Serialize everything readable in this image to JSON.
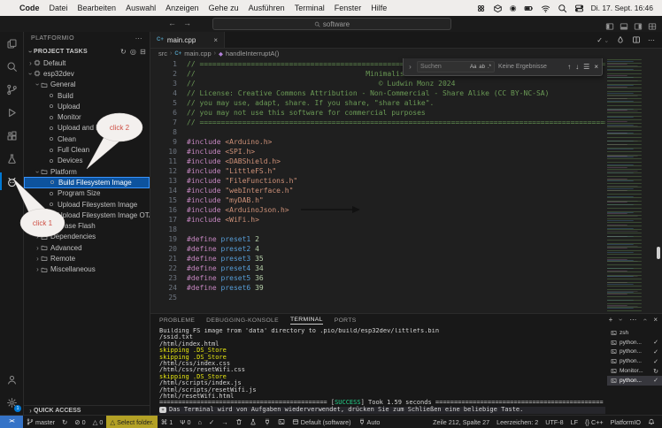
{
  "colors": {
    "accent": "#0078d4",
    "selBg": "#0d539e",
    "selBorder": "#3794ff",
    "remoteBlue": "#3573c7",
    "warnBadge": "#b3a125",
    "termYellow": "#e5e510",
    "success": "#23d18b",
    "annRed": "#cf4f44"
  },
  "menubar": {
    "apple": "",
    "items": [
      "Code",
      "Datei",
      "Bearbeiten",
      "Auswahl",
      "Anzeigen",
      "Gehe zu",
      "Ausführen",
      "Terminal",
      "Fenster",
      "Hilfe"
    ],
    "clock": "Di. 17. Sept. 16:46"
  },
  "titlebar": {
    "back": "←",
    "forward": "→",
    "search": "software"
  },
  "sidebar": {
    "title": "PLATFORMIO",
    "more": "⋯",
    "section": "PROJECT TASKS",
    "section_icons": [
      "refresh",
      "group",
      "collapse"
    ],
    "quick_access": "QUICK ACCESS",
    "tree": [
      {
        "label": "Default",
        "lvl": 1,
        "chev": "r",
        "icon": "board"
      },
      {
        "label": "esp32dev",
        "lvl": 1,
        "chev": "d",
        "icon": "board"
      },
      {
        "label": "General",
        "lvl": 2,
        "chev": "d",
        "icon": "folder"
      },
      {
        "label": "Build",
        "lvl": 3,
        "icon": "task"
      },
      {
        "label": "Upload",
        "lvl": 3,
        "icon": "task"
      },
      {
        "label": "Monitor",
        "lvl": 3,
        "icon": "task"
      },
      {
        "label": "Upload and Monitor",
        "lvl": 3,
        "icon": "task"
      },
      {
        "label": "Clean",
        "lvl": 3,
        "icon": "task"
      },
      {
        "label": "Full Clean",
        "lvl": 3,
        "icon": "task"
      },
      {
        "label": "Devices",
        "lvl": 3,
        "icon": "task"
      },
      {
        "label": "Platform",
        "lvl": 2,
        "chev": "d",
        "icon": "folder"
      },
      {
        "label": "Build Filesystem Image",
        "lvl": 3,
        "icon": "task",
        "selected": true
      },
      {
        "label": "Program Size",
        "lvl": 3,
        "icon": "task"
      },
      {
        "label": "Upload Filesystem Image",
        "lvl": 3,
        "icon": "task"
      },
      {
        "label": "Upload Filesystem Image OTA",
        "lvl": 3,
        "icon": "task"
      },
      {
        "label": "Erase Flash",
        "lvl": 3,
        "icon": "task"
      },
      {
        "label": "Dependencies",
        "lvl": 2,
        "chev": "r",
        "icon": "folder"
      },
      {
        "label": "Advanced",
        "lvl": 2,
        "chev": "r",
        "icon": "folder"
      },
      {
        "label": "Remote",
        "lvl": 2,
        "chev": "r",
        "icon": "folder"
      },
      {
        "label": "Miscellaneous",
        "lvl": 2,
        "chev": "r",
        "icon": "folder"
      }
    ]
  },
  "editor": {
    "tab_label": "main.cpp",
    "tab_close": "×",
    "breadcrumbs": [
      "src",
      "main.cpp",
      "handleInterruptA()"
    ],
    "find": {
      "placeholder": "Suchen",
      "opts": [
        "Aa",
        "ab",
        ".*"
      ],
      "results": "Keine Ergebnisse",
      "nav": [
        "↑",
        "↓",
        "☰",
        "×"
      ]
    },
    "code_lines": [
      {
        "n": 1,
        "s": [
          [
            "// ================================================================================================",
            "c"
          ]
        ]
      },
      {
        "n": 2,
        "s": [
          [
            "//                                        Minimalist DAB+ radio",
            "c"
          ]
        ]
      },
      {
        "n": 3,
        "s": [
          [
            "//                                           © Ludwin Monz 2024",
            "c"
          ]
        ]
      },
      {
        "n": 4,
        "s": [
          [
            "// License: Creative Commons Attribution - Non-Commercial - Share Alike (CC BY-NC-SA)",
            "c"
          ]
        ]
      },
      {
        "n": 5,
        "s": [
          [
            "// you may use, adapt, share. If you share, \"share alike\".",
            "c"
          ]
        ]
      },
      {
        "n": 6,
        "s": [
          [
            "// you may not use this software for commercial purposes",
            "c"
          ]
        ]
      },
      {
        "n": 7,
        "s": [
          [
            "// ================================================================================================",
            "c"
          ]
        ]
      },
      {
        "n": 8,
        "s": []
      },
      {
        "n": 9,
        "s": [
          [
            "#include ",
            "k"
          ],
          [
            "<Arduino.h>",
            "s"
          ]
        ]
      },
      {
        "n": 10,
        "s": [
          [
            "#include ",
            "k"
          ],
          [
            "<SPI.h>",
            "s"
          ]
        ]
      },
      {
        "n": 11,
        "s": [
          [
            "#include ",
            "k"
          ],
          [
            "<DABShield.h>",
            "s"
          ]
        ]
      },
      {
        "n": 12,
        "s": [
          [
            "#include ",
            "k"
          ],
          [
            "\"LittleFS.h\"",
            "s"
          ]
        ]
      },
      {
        "n": 13,
        "s": [
          [
            "#include ",
            "k"
          ],
          [
            "\"FileFunctions.h\"",
            "s"
          ]
        ]
      },
      {
        "n": 14,
        "s": [
          [
            "#include ",
            "k"
          ],
          [
            "\"webInterface.h\"",
            "s"
          ]
        ]
      },
      {
        "n": 15,
        "s": [
          [
            "#include ",
            "k"
          ],
          [
            "\"myDAB.h\"",
            "s"
          ]
        ]
      },
      {
        "n": 16,
        "s": [
          [
            "#include ",
            "k"
          ],
          [
            "<ArduinoJson.h>",
            "s"
          ]
        ]
      },
      {
        "n": 17,
        "s": [
          [
            "#include ",
            "k"
          ],
          [
            "<WiFi.h>",
            "s"
          ]
        ]
      },
      {
        "n": 18,
        "s": []
      },
      {
        "n": 19,
        "s": [
          [
            "#define ",
            "k"
          ],
          [
            "preset1",
            "m"
          ],
          [
            " 2",
            "n"
          ]
        ]
      },
      {
        "n": 20,
        "s": [
          [
            "#define ",
            "k"
          ],
          [
            "preset2",
            "m"
          ],
          [
            " 4",
            "n"
          ]
        ]
      },
      {
        "n": 21,
        "s": [
          [
            "#define ",
            "k"
          ],
          [
            "preset3",
            "m"
          ],
          [
            " 35",
            "n"
          ]
        ]
      },
      {
        "n": 22,
        "s": [
          [
            "#define ",
            "k"
          ],
          [
            "preset4",
            "m"
          ],
          [
            " 34",
            "n"
          ]
        ]
      },
      {
        "n": 23,
        "s": [
          [
            "#define ",
            "k"
          ],
          [
            "preset5",
            "m"
          ],
          [
            " 36",
            "n"
          ]
        ]
      },
      {
        "n": 24,
        "s": [
          [
            "#define ",
            "k"
          ],
          [
            "preset6",
            "m"
          ],
          [
            " 39",
            "n"
          ]
        ]
      },
      {
        "n": 25,
        "s": []
      }
    ]
  },
  "panel": {
    "tabs": [
      {
        "label": "PROBLEME"
      },
      {
        "label": "DEBUGGING-KONSOLE"
      },
      {
        "label": "TERMINAL",
        "active": true
      },
      {
        "label": "PORTS"
      }
    ],
    "actions": [
      "+",
      "chev-d",
      "⋯",
      "chev-u",
      "×"
    ],
    "lines": [
      {
        "s": [
          [
            "Building FS image from 'data' directory to .pio/build/esp32dev/littlefs.bin",
            "t"
          ]
        ]
      },
      {
        "s": [
          [
            "/ssid.txt",
            "t"
          ]
        ]
      },
      {
        "s": [
          [
            "/html/index.html",
            "t"
          ]
        ]
      },
      {
        "s": [
          [
            "skipping .DS_Store",
            "y"
          ]
        ]
      },
      {
        "s": [
          [
            "skipping .DS_Store",
            "y"
          ]
        ]
      },
      {
        "s": [
          [
            "/html/css/index.css",
            "t"
          ]
        ]
      },
      {
        "s": [
          [
            "/html/css/resetWifi.css",
            "t"
          ]
        ]
      },
      {
        "s": [
          [
            "skipping .DS_Store",
            "y"
          ]
        ]
      },
      {
        "s": [
          [
            "/html/scripts/index.js",
            "t"
          ]
        ]
      },
      {
        "s": [
          [
            "/html/scripts/resetWifi.js",
            "t"
          ]
        ]
      },
      {
        "s": [
          [
            "/html/resetWifi.html",
            "t"
          ]
        ]
      },
      {
        "s": [
          [
            "============================================= [",
            "t"
          ],
          [
            "SUCCESS",
            "ok"
          ],
          [
            "] Took 1.59 seconds ",
            "t"
          ],
          [
            "=============================================",
            "t"
          ]
        ]
      },
      {
        "reuse": true,
        "s": [
          [
            "Das Terminal wird von Aufgaben wiederverwendet, drücken Sie zum Schließen eine beliebige Taste.",
            "t"
          ]
        ]
      }
    ],
    "sessions": [
      {
        "label": "zsh",
        "status": ""
      },
      {
        "label": "python...",
        "status": "check"
      },
      {
        "label": "python...",
        "status": "check"
      },
      {
        "label": "python...",
        "status": "check"
      },
      {
        "label": "Monitor...",
        "status": "progress"
      },
      {
        "label": "python...",
        "status": "check",
        "selected": true
      }
    ]
  },
  "status_bar": {
    "left": [
      {
        "name": "remote-indicator",
        "icon": "remote",
        "label": "><",
        "style": "remote"
      },
      {
        "name": "git-branch",
        "icon": "branch",
        "label": "master"
      },
      {
        "name": "sync",
        "icon": "sync",
        "label": ""
      },
      {
        "name": "errors",
        "icon": "error",
        "label": "0"
      },
      {
        "name": "warnings",
        "icon": "warning",
        "label": "0"
      },
      {
        "name": "select-folder",
        "icon": "warning",
        "label": "Select folder.",
        "style": "warnbadge"
      },
      {
        "name": "cmd-count",
        "icon": "cmd",
        "label": "1"
      },
      {
        "name": "usb-count",
        "icon": "usb",
        "label": "0"
      },
      {
        "name": "pio-home",
        "icon": "home",
        "label": ""
      },
      {
        "name": "pio-build",
        "icon": "check",
        "label": ""
      },
      {
        "name": "pio-upload",
        "icon": "arrow",
        "label": ""
      },
      {
        "name": "pio-clean",
        "icon": "trash",
        "label": ""
      },
      {
        "name": "pio-test",
        "icon": "flask",
        "label": ""
      },
      {
        "name": "pio-monitor",
        "icon": "plug",
        "label": ""
      },
      {
        "name": "pio-terminal",
        "icon": "term",
        "label": ""
      },
      {
        "name": "pio-env",
        "icon": "envbox",
        "label": "Default (software)"
      },
      {
        "name": "serial-port",
        "icon": "plug",
        "label": "Auto"
      }
    ],
    "right": [
      {
        "name": "cursor-position",
        "label": "Zeile 212, Spalte 27"
      },
      {
        "name": "indentation",
        "label": "Leerzeichen: 2"
      },
      {
        "name": "encoding",
        "label": "UTF-8"
      },
      {
        "name": "eol",
        "label": "LF"
      },
      {
        "name": "language-mode",
        "icon": "braces",
        "label": "C++"
      },
      {
        "name": "platformio-status",
        "label": "PlatformIO"
      },
      {
        "name": "notifications",
        "icon": "bell",
        "label": ""
      }
    ]
  },
  "annotations": {
    "click1": "click 1",
    "click2": "click 2"
  }
}
